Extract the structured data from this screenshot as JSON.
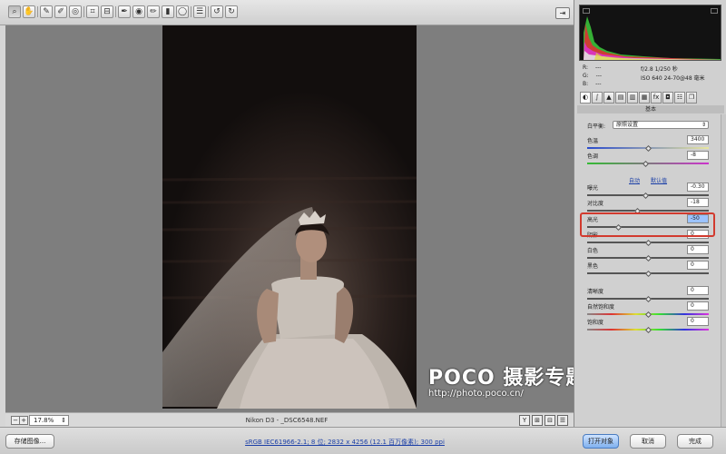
{
  "toolbar": {
    "tools": [
      "zoom-icon",
      "hand-icon",
      "white-balance-icon",
      "color-sampler-icon",
      "target-adjust-icon",
      "crop-icon",
      "straighten-icon",
      "spot-removal-icon",
      "red-eye-icon",
      "adjustment-brush-icon",
      "graduated-filter-icon",
      "radial-filter-icon",
      "preferences-icon",
      "rotate-left-icon",
      "rotate-right-icon"
    ]
  },
  "preview": {
    "zoom": "17.8%",
    "filename": "Nikon D3 - _DSC6548.NEF"
  },
  "histogram": {
    "rgb_labels": [
      "R:",
      "G:",
      "B:"
    ],
    "rgb_values": [
      "---",
      "---",
      "---"
    ],
    "aperture_shutter": "f/2.8   1/250 秒",
    "iso_lens": "ISO 640   24-70@48 毫米"
  },
  "panel": {
    "section_title": "基本",
    "white_balance_label": "白平衡:",
    "white_balance_value": "原照设置",
    "auto_link": "自动",
    "default_link": "默认值"
  },
  "sliders": [
    {
      "id": "temperature",
      "label": "色温",
      "value": "3400",
      "level": 0.5
    },
    {
      "id": "tint",
      "label": "色调",
      "value": "-8",
      "level": 0.48
    },
    {
      "id": "exposure",
      "label": "曝光",
      "value": "-0.30",
      "level": 0.48
    },
    {
      "id": "contrast",
      "label": "对比度",
      "value": "-18",
      "level": 0.41
    },
    {
      "id": "highlights",
      "label": "高光",
      "value": "-50",
      "level": 0.25
    },
    {
      "id": "shadows",
      "label": "阴影",
      "value": "0",
      "level": 0.5
    },
    {
      "id": "whites",
      "label": "白色",
      "value": "0",
      "level": 0.5
    },
    {
      "id": "blacks",
      "label": "黑色",
      "value": "0",
      "level": 0.5
    },
    {
      "id": "clarity",
      "label": "清晰度",
      "value": "0",
      "level": 0.5
    },
    {
      "id": "vibrance",
      "label": "自然饱和度",
      "value": "0",
      "level": 0.5
    },
    {
      "id": "saturation",
      "label": "饱和度",
      "value": "0",
      "level": 0.5
    }
  ],
  "bottom": {
    "save_label": "存储图像...",
    "workflow_text": "sRGB IEC61966-2.1; 8 位; 2832 x 4256 (12.1 百万像素); 300 ppi",
    "open_label": "打开对象",
    "cancel_label": "取消",
    "done_label": "完成"
  },
  "watermark": {
    "logo_text": "POCO 摄影专题",
    "url": "http://photo.poco.cn/"
  },
  "colors": {
    "highlight_box": "#d23a2e",
    "primary_button": "#7fb0ee"
  }
}
